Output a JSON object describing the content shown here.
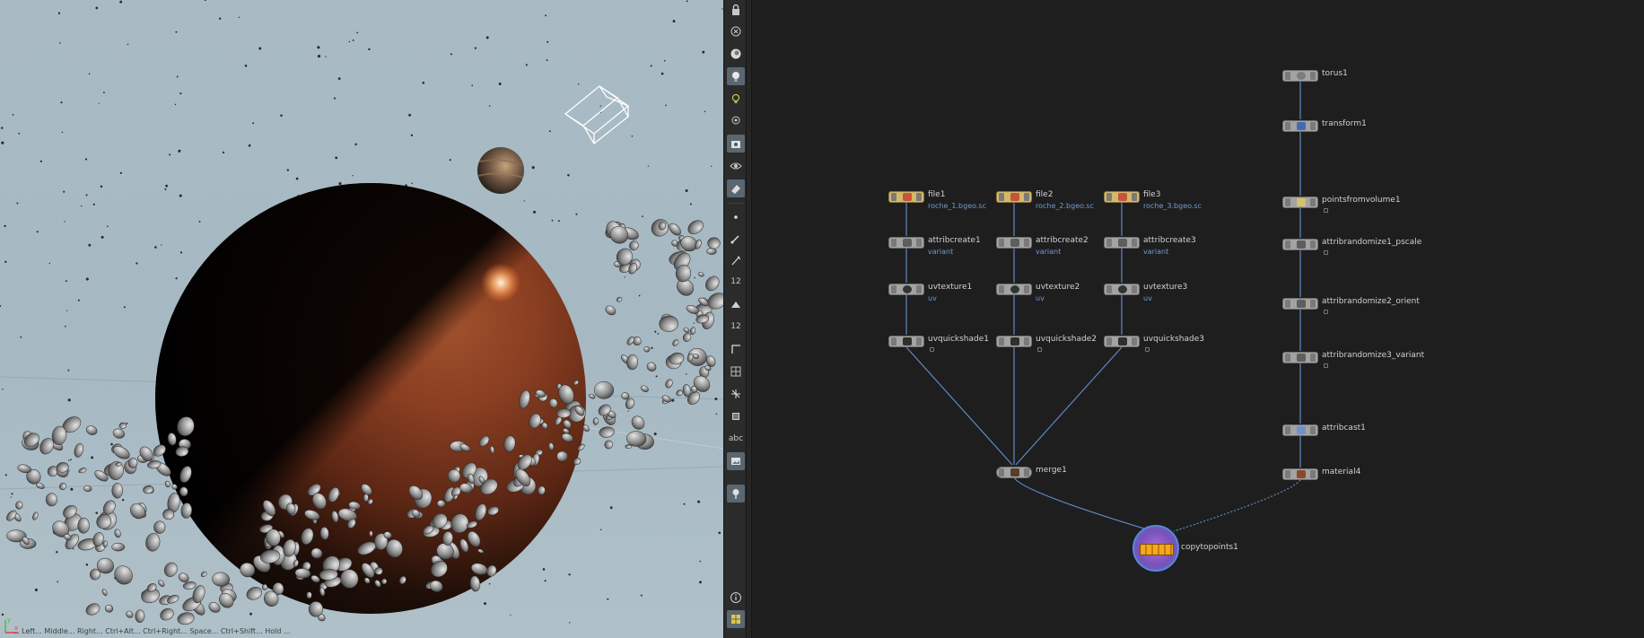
{
  "viewport": {
    "hint_text": "... Left... Middle... Right... Ctrl+Alt... Ctrl+Right... Space... Ctrl+Shift... Hold ...",
    "axis_labels": {
      "x": "x",
      "y": "y"
    },
    "sky_color": "#a9bac3",
    "planet_color": "#7a3a1f"
  },
  "toolbar": {
    "items": [
      {
        "name": "lock-icon"
      },
      {
        "name": "close-icon"
      },
      {
        "name": "display-options-icon"
      },
      {
        "name": "lighting-icon"
      },
      {
        "name": "headlight-icon"
      },
      {
        "name": "no-lighting-icon"
      },
      {
        "name": "camera-icon"
      },
      {
        "name": "eye-icon"
      },
      {
        "name": "snapshot-icon"
      },
      {
        "name": "point-icon"
      },
      {
        "name": "brush-icon"
      },
      {
        "name": "pen-icon"
      },
      {
        "name": "numbers-icon",
        "text": "12"
      },
      {
        "name": "paint-icon"
      },
      {
        "name": "numbers2-icon",
        "text": "12"
      },
      {
        "name": "corner-icon"
      },
      {
        "name": "grid-icon"
      },
      {
        "name": "transform-icon"
      },
      {
        "name": "box-icon"
      },
      {
        "name": "text-icon",
        "text": "abc"
      },
      {
        "name": "image-icon"
      },
      {
        "name": "pin-icon"
      },
      {
        "name": "info-icon"
      },
      {
        "name": "layout-icon"
      }
    ]
  },
  "network": {
    "wire_color": "#5f89c4",
    "nodes": {
      "file1": {
        "label": "file1",
        "sub": "roche_1.bgeo.sc"
      },
      "file2": {
        "label": "file2",
        "sub": "roche_2.bgeo.sc"
      },
      "file3": {
        "label": "file3",
        "sub": "roche_3.bgeo.sc"
      },
      "attribcreate1": {
        "label": "attribcreate1",
        "sub": "variant"
      },
      "attribcreate2": {
        "label": "attribcreate2",
        "sub": "variant"
      },
      "attribcreate3": {
        "label": "attribcreate3",
        "sub": "variant"
      },
      "uvtexture1": {
        "label": "uvtexture1",
        "sub": "uv"
      },
      "uvtexture2": {
        "label": "uvtexture2",
        "sub": "uv"
      },
      "uvtexture3": {
        "label": "uvtexture3",
        "sub": "uv"
      },
      "uvquickshade1": {
        "label": "uvquickshade1"
      },
      "uvquickshade2": {
        "label": "uvquickshade2"
      },
      "uvquickshade3": {
        "label": "uvquickshade3"
      },
      "merge1": {
        "label": "merge1"
      },
      "torus1": {
        "label": "torus1"
      },
      "transform1": {
        "label": "transform1"
      },
      "pointsfromvolume1": {
        "label": "pointsfromvolume1"
      },
      "attribrandomize1_pscale": {
        "label": "attribrandomize1_pscale"
      },
      "attribrandomize2_orient": {
        "label": "attribrandomize2_orient"
      },
      "attribrandomize3_variant": {
        "label": "attribrandomize3_variant"
      },
      "attribcast1": {
        "label": "attribcast1"
      },
      "material4": {
        "label": "material4"
      },
      "copytopoints1": {
        "label": "copytopoints1"
      }
    }
  }
}
